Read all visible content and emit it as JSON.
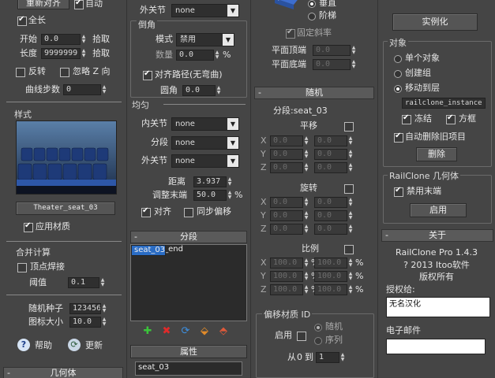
{
  "panel1": {
    "reset_align_label": "重新对齐",
    "auto_label": "自动",
    "full_length_label": "全长",
    "start_label": "开始",
    "start_value": "0.0",
    "pick_label": "拾取",
    "length_label": "长度",
    "length_value": "9999999",
    "pick2_label": "拾取",
    "reverse_label": "反转",
    "ignore_z_label": "忽略 Z 向",
    "curve_steps_label": "曲线步数",
    "curve_steps_value": "0",
    "style_title": "样式",
    "thumbnail_caption": "Theater_seat_03",
    "apply_material_label": "应用材质",
    "merge_title": "合并计算",
    "weld_vertices_label": "顶点焊接",
    "threshold_label": "阈值",
    "threshold_value": "0.1",
    "random_seed_label": "随机种子",
    "random_seed_value": "123456",
    "icon_size_label": "图标大小",
    "icon_size_value": "10.0",
    "help_label": "帮助",
    "update_label": "更新",
    "geometry_rollout": "几何体"
  },
  "panel2": {
    "outer_node_label": "外关节",
    "outer_node_value": "none",
    "chamfer_title": "倒角",
    "mode_label": "模式",
    "mode_value": "禁用",
    "amount_label": "数量",
    "amount_value": "0.0",
    "pct": "%",
    "align_path_label": "对齐路径(无弯曲)",
    "fillet_label": "圆角",
    "fillet_value": "0.0",
    "uniform_title": "均匀",
    "inner_node_label": "内关节",
    "inner_node_value": "none",
    "segment_label": "分段",
    "segment_value": "none",
    "outer_node2_label": "外关节",
    "outer_node2_value": "none",
    "distance_label": "距离",
    "distance_value": "3.937",
    "adjust_end_label": "调整末端",
    "adjust_end_value": "50.0",
    "align_label": "对齐",
    "sync_offset_label": "同步偏移",
    "segments_rollout": "分段",
    "segment_items": [
      "seat_03",
      "seat_03_end"
    ],
    "properties_label": "属性",
    "property_value": "seat_03"
  },
  "panel3": {
    "vertical_label": "垂直",
    "stepped_label": "阶梯",
    "fixed_slope_label": "固定斜率",
    "flat_top_label": "平面顶端",
    "flat_top_value": "0.0",
    "flat_bottom_label": "平面底端",
    "flat_bottom_value": "0.0",
    "random_rollout": "随机",
    "segment_name": "分段:seat_03",
    "translate_label": "平移",
    "rotate_label": "旋转",
    "scale_label": "比例",
    "axes": [
      "X",
      "Y",
      "Z"
    ],
    "zero": "0.0",
    "hundred": "100.0",
    "material_offset_title": "偏移材质 ID",
    "enable_label": "启用",
    "random_label": "随机",
    "sequence_label": "序列",
    "from_label": "从",
    "from_value": "0",
    "to_label": "到",
    "to_value": "1"
  },
  "panel4": {
    "instance_button": "实例化",
    "object_title": "对象",
    "single_object_label": "单个对象",
    "create_group_label": "创建组",
    "move_to_layer_label": "移动到层",
    "layer_value": "railclone_instance",
    "freeze_label": "冻结",
    "box_label": "方框",
    "auto_delete_label": "自动删除旧项目",
    "delete_button": "删除",
    "geometry_title": "RailClone 几何体",
    "disable_end_label": "禁用末端",
    "enable_button": "启用",
    "about_rollout": "关于",
    "version": "RailClone Pro 1.4.3",
    "copyright": "? 2013 Itoo软件",
    "rights": "版权所有",
    "license_title": "授权给:",
    "licensee": "无名汉化",
    "email_title": "电子邮件"
  }
}
